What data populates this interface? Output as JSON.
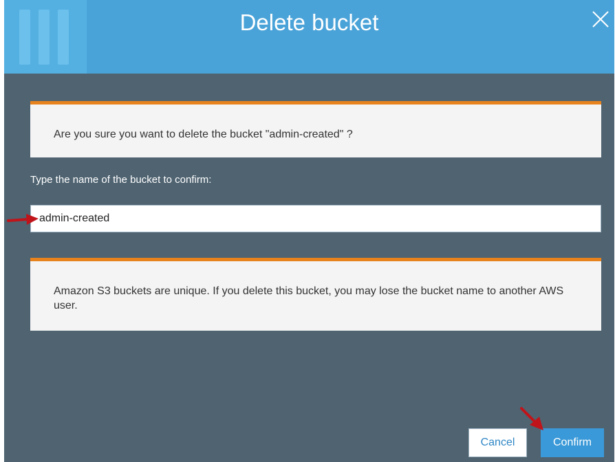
{
  "dialog": {
    "title": "Delete bucket",
    "confirm_message": "Are you sure you want to delete the bucket \"admin-created\" ?",
    "input_label": "Type the name of the bucket to confirm:",
    "input_value": "admin-created",
    "warning_message": "Amazon S3 buckets are unique. If you delete this bucket, you may lose the bucket name to another AWS user.",
    "cancel_label": "Cancel",
    "confirm_label": "Confirm"
  },
  "icons": {
    "close": "close-icon",
    "arrow": "red-arrow-icon"
  },
  "colors": {
    "header": "#4aa3d8",
    "body": "#4f6371",
    "accent": "#e8821d",
    "primary_button": "#3a99d8",
    "annotation_arrow": "#c0141a"
  }
}
